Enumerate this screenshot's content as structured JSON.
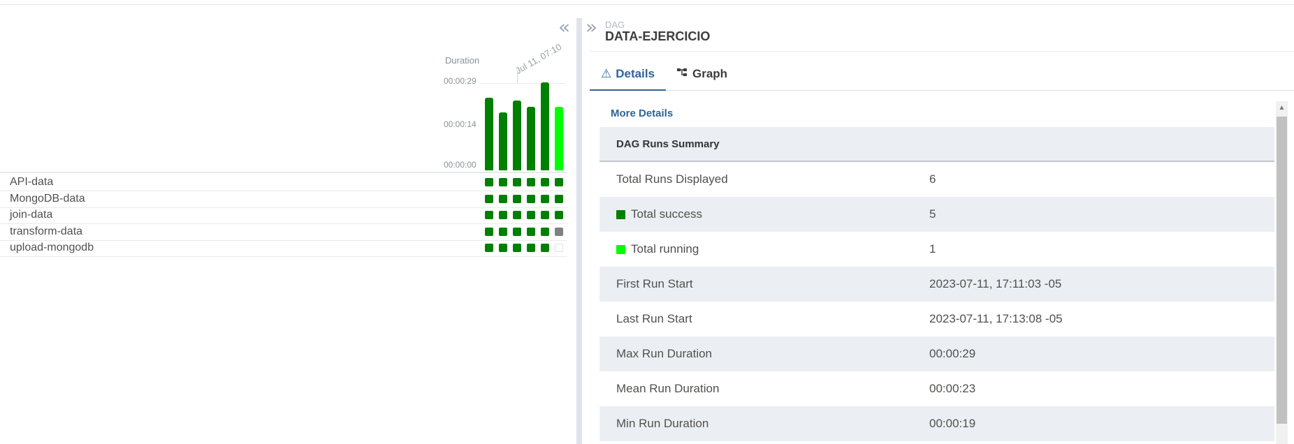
{
  "grid": {
    "collapse_icon_glyph": "«",
    "duration_label": "Duration",
    "date_label": "Jul 11, 07:10",
    "axis_labels": [
      "00:00:29",
      "00:00:14",
      "00:00:00"
    ],
    "colors": {
      "success": "#008000",
      "running": "#00ff00",
      "upstream_failed_or_queued": "#808080",
      "no_status_border": "#e0e0e0"
    },
    "runs": [
      {
        "duration_seconds": 24,
        "state": "success"
      },
      {
        "duration_seconds": 19,
        "state": "success"
      },
      {
        "duration_seconds": 23,
        "state": "success"
      },
      {
        "duration_seconds": 21,
        "state": "success"
      },
      {
        "duration_seconds": 29,
        "state": "success"
      },
      {
        "duration_seconds": 21,
        "state": "running"
      }
    ],
    "tasks": [
      {
        "name": "API-data",
        "states": [
          "success",
          "success",
          "success",
          "success",
          "success",
          "success"
        ]
      },
      {
        "name": "MongoDB-data",
        "states": [
          "success",
          "success",
          "success",
          "success",
          "success",
          "success"
        ]
      },
      {
        "name": "join-data",
        "states": [
          "success",
          "success",
          "success",
          "success",
          "success",
          "success"
        ]
      },
      {
        "name": "transform-data",
        "states": [
          "success",
          "success",
          "success",
          "success",
          "success",
          "queued"
        ]
      },
      {
        "name": "upload-mongodb",
        "states": [
          "success",
          "success",
          "success",
          "success",
          "success",
          "none"
        ]
      }
    ]
  },
  "details": {
    "expand_icon_glyph": "»",
    "caption": "DAG",
    "title": "DATA-EJERCICIO",
    "tabs": [
      {
        "label": "Details",
        "icon": "warning-triangle-icon",
        "glyph": "⚠",
        "active": true
      },
      {
        "label": "Graph",
        "icon": "graph-tree-icon",
        "glyph": "⊞",
        "active": false
      }
    ],
    "more_details": "More Details",
    "summary_title": "DAG Runs Summary",
    "rows": [
      {
        "label": "Total Runs Displayed",
        "value": "6"
      },
      {
        "label": "Total success",
        "value": "5",
        "legend_color": "#008000"
      },
      {
        "label": "Total running",
        "value": "1",
        "legend_color": "#00ff00"
      },
      {
        "label": "First Run Start",
        "value": "2023-07-11, 17:11:03 -05"
      },
      {
        "label": "Last Run Start",
        "value": "2023-07-11, 17:13:08 -05"
      },
      {
        "label": "Max Run Duration",
        "value": "00:00:29"
      },
      {
        "label": "Mean Run Duration",
        "value": "00:00:23"
      },
      {
        "label": "Min Run Duration",
        "value": "00:00:19"
      }
    ]
  }
}
